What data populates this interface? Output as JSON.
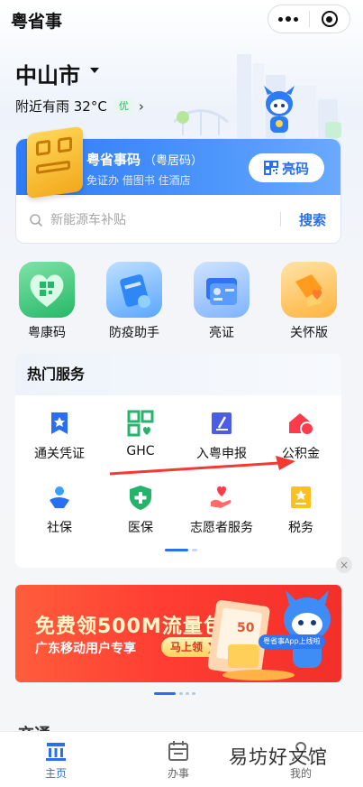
{
  "app": {
    "title": "粤省事"
  },
  "header": {
    "city": "中山市",
    "weather": "附近有雨 32°C",
    "aqi": "优"
  },
  "qr_card": {
    "title": "粤省事码",
    "title_suffix": "（粤居码）",
    "subtitle": "免证办 借图书 住酒店",
    "button_label": "亮码"
  },
  "search": {
    "placeholder": "新能源车补贴",
    "button_label": "搜索"
  },
  "quick_actions": [
    {
      "label": "粤康码",
      "icon": "health-code-icon"
    },
    {
      "label": "防疫助手",
      "icon": "epidemic-assistant-icon"
    },
    {
      "label": "亮证",
      "icon": "certificate-icon"
    },
    {
      "label": "关怀版",
      "icon": "care-version-icon"
    }
  ],
  "hot_services": {
    "title": "热门服务",
    "items": [
      {
        "label": "通关凭证",
        "icon": "customs-pass-icon"
      },
      {
        "label": "GHC",
        "icon": "ghc-icon"
      },
      {
        "label": "入粤申报",
        "icon": "entry-declaration-icon"
      },
      {
        "label": "公积金",
        "icon": "housing-fund-icon"
      },
      {
        "label": "社保",
        "icon": "social-security-icon"
      },
      {
        "label": "医保",
        "icon": "medical-insurance-icon"
      },
      {
        "label": "志愿者服务",
        "icon": "volunteer-icon"
      },
      {
        "label": "税务",
        "icon": "tax-icon"
      }
    ]
  },
  "banner": {
    "title": "免费领500M流量包",
    "subtitle": "广东移动用户专享",
    "button_label": "马上领",
    "badge": "粤省事App上线啦",
    "ticket_number": "50"
  },
  "section_peek": "交通",
  "tabbar": {
    "items": [
      {
        "label": "主页",
        "active": true
      },
      {
        "label": "办事",
        "active": false
      },
      {
        "label": "我的",
        "active": false
      }
    ]
  },
  "watermark": "易坊好文馆",
  "colors": {
    "accent": "#2a6ff0",
    "banner": "#ff3d32",
    "qr_yellow": "#f2a81c"
  }
}
